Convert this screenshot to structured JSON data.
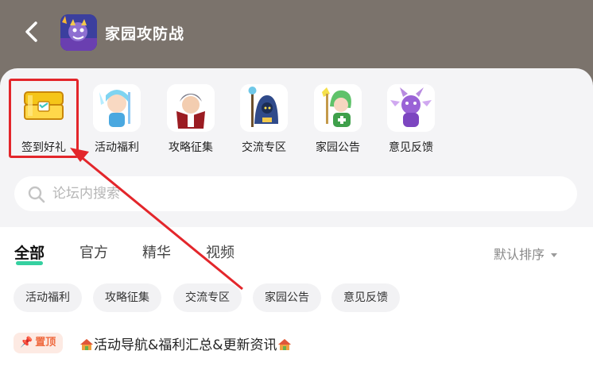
{
  "header": {
    "title": "家园攻防战"
  },
  "shortcuts": [
    {
      "label": "签到好礼"
    },
    {
      "label": "活动福利"
    },
    {
      "label": "攻略征集"
    },
    {
      "label": "交流专区"
    },
    {
      "label": "家园公告"
    },
    {
      "label": "意见反馈"
    }
  ],
  "search": {
    "placeholder": "论坛内搜索"
  },
  "tabs": [
    {
      "label": "全部"
    },
    {
      "label": "官方"
    },
    {
      "label": "精华"
    },
    {
      "label": "视频"
    }
  ],
  "sort": {
    "label": "默认排序"
  },
  "chips": [
    {
      "label": "活动福利"
    },
    {
      "label": "攻略征集"
    },
    {
      "label": "交流专区"
    },
    {
      "label": "家园公告"
    },
    {
      "label": "意见反馈"
    }
  ],
  "pinned_post": {
    "badge": "置顶",
    "title": "活动导航&福利汇总&更新资讯"
  },
  "colors": {
    "header_bg": "#7b736c",
    "accent_green": "#35d0a0",
    "annotation_red": "#e3262b",
    "pin_orange": "#ef6a3f"
  },
  "icons": [
    "back-arrow-icon",
    "treasure-chest-icon",
    "search-icon",
    "pin-icon",
    "house-icon"
  ]
}
